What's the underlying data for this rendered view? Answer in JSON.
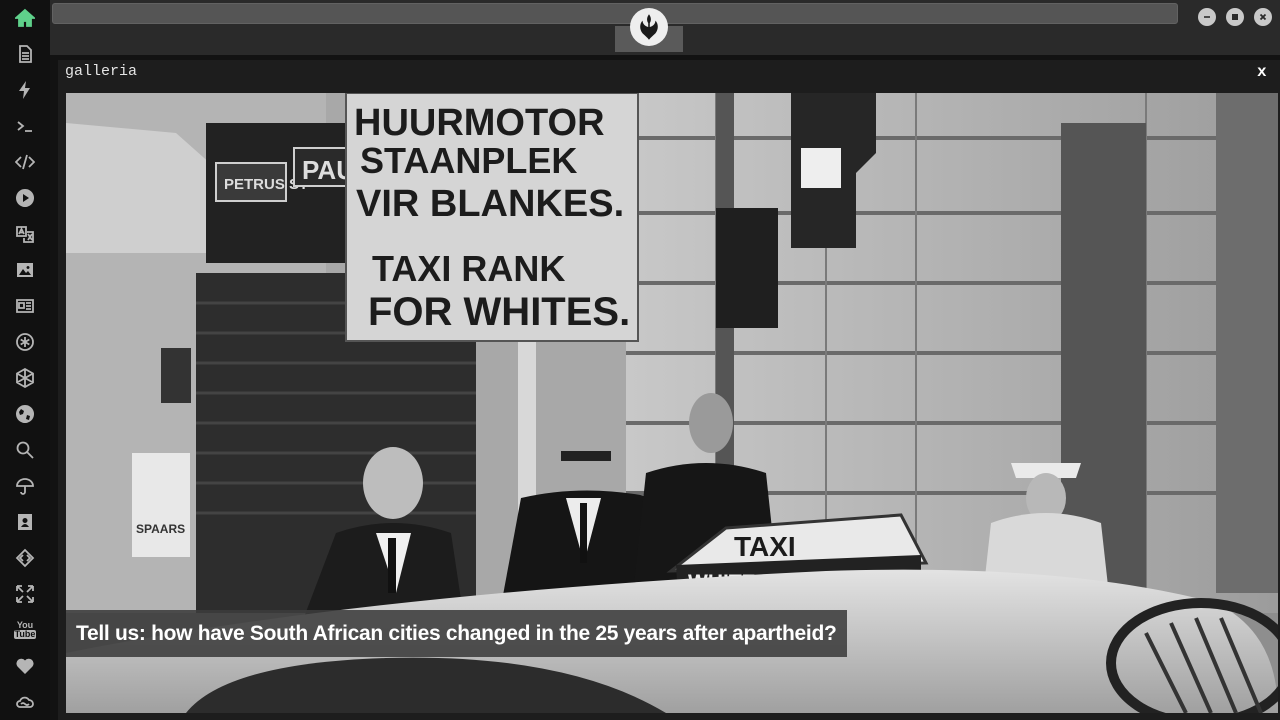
{
  "app": {
    "accent_color": "#5fd18b",
    "sidebar": {
      "items": [
        {
          "name": "home-icon",
          "active": true
        },
        {
          "name": "document-icon"
        },
        {
          "name": "lightning-icon"
        },
        {
          "name": "terminal-icon"
        },
        {
          "name": "code-icon"
        },
        {
          "name": "play-icon"
        },
        {
          "name": "translate-icon"
        },
        {
          "name": "image-icon"
        },
        {
          "name": "newspaper-icon"
        },
        {
          "name": "asterisk-circle-icon"
        },
        {
          "name": "hexagon-icon"
        },
        {
          "name": "globe-icon"
        },
        {
          "name": "search-icon"
        },
        {
          "name": "umbrella-icon"
        },
        {
          "name": "contact-card-icon"
        },
        {
          "name": "embed-code-icon"
        },
        {
          "name": "expand-icon"
        },
        {
          "name": "youtube-icon",
          "label": "You Tube"
        },
        {
          "name": "heart-icon"
        },
        {
          "name": "infinity-cloud-icon"
        }
      ]
    },
    "topbar": {
      "logo_icon": "rebel-alliance-icon",
      "window_controls": [
        "minimize-icon",
        "maximize-icon",
        "close-icon"
      ]
    }
  },
  "panel": {
    "title": "galleria",
    "close_label": "x"
  },
  "photo": {
    "sign_text": [
      "HUURMOTOR",
      "STAANPLEK",
      "VIR BLANKES.",
      "TAXI RANK",
      "FOR WHITES."
    ],
    "street_sign": "PETRUS ST",
    "shop_sign": "PAU",
    "taxi_sign_line1": "TAXI",
    "taxi_sign_line2": "WHITE PERSONS",
    "poster_text": "SPAARS"
  },
  "caption": {
    "text": "Tell us: how have South African cities changed in the 25 years after apartheid?"
  }
}
